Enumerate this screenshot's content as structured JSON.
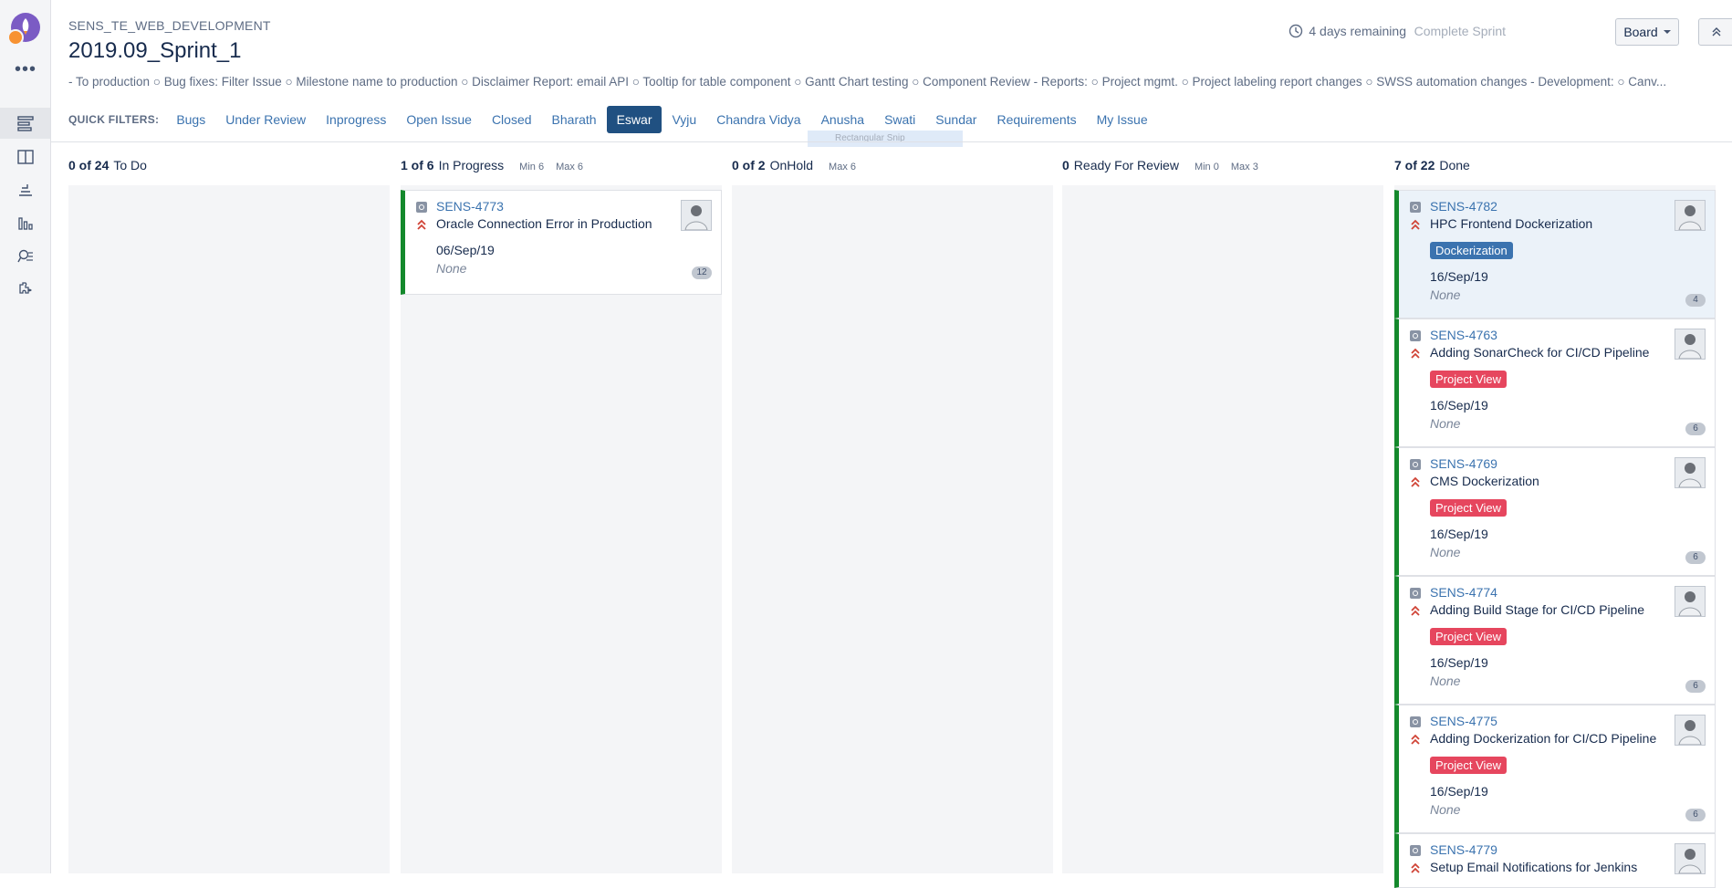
{
  "project": {
    "name": "SENS_TE_WEB_DEVELOPMENT"
  },
  "sprint": {
    "title": "2019.09_Sprint_1",
    "goal": "- To production ○ Bug fixes: Filter Issue ○ Milestone name to production ○ Disclaimer Report: email API ○ Tooltip for table component ○ Gantt Chart testing ○ Component Review - Reports: ○ Project mgmt. ○ Project labeling report changes ○ SWSS automation changes - Development: ○ Canv...",
    "remaining": "4 days remaining",
    "complete_label": "Complete Sprint"
  },
  "toolbar": {
    "board_label": "Board"
  },
  "quick_filters": {
    "label": "QUICK FILTERS:",
    "items": [
      "Bugs",
      "Under Review",
      "Inprogress",
      "Open Issue",
      "Closed",
      "Bharath",
      "Eswar",
      "Vyju",
      "Chandra Vidya",
      "Anusha",
      "Swati",
      "Sundar",
      "Requirements",
      "My Issue"
    ],
    "active": "Eswar"
  },
  "snip_overlay": "Rectangular Snip",
  "columns": [
    {
      "count": "0 of 24",
      "name": "To Do",
      "min": "",
      "max": ""
    },
    {
      "count": "1 of 6",
      "name": "In Progress",
      "min": "Min 6",
      "max": "Max 6"
    },
    {
      "count": "0 of 2",
      "name": "OnHold",
      "min": "",
      "max": "Max 6"
    },
    {
      "count": "0",
      "name": "Ready For Review",
      "min": "Min 0",
      "max": "Max 3"
    },
    {
      "count": "7 of 22",
      "name": "Done",
      "min": "",
      "max": ""
    }
  ],
  "cards_inprogress": [
    {
      "key": "SENS-4773",
      "summary": "Oracle Connection Error in Production",
      "date": "06/Sep/19",
      "due": "None",
      "count": "12"
    }
  ],
  "cards_done": [
    {
      "key": "SENS-4782",
      "summary": "HPC Frontend Dockerization",
      "epic": "Dockerization",
      "date": "16/Sep/19",
      "due": "None",
      "count": "4"
    },
    {
      "key": "SENS-4763",
      "summary": "Adding SonarCheck for CI/CD Pipeline",
      "epic": "Project View",
      "date": "16/Sep/19",
      "due": "None",
      "count": "6"
    },
    {
      "key": "SENS-4769",
      "summary": "CMS Dockerization",
      "epic": "Project View",
      "date": "16/Sep/19",
      "due": "None",
      "count": "6"
    },
    {
      "key": "SENS-4774",
      "summary": "Adding Build Stage for CI/CD Pipeline",
      "epic": "Project View",
      "date": "16/Sep/19",
      "due": "None",
      "count": "6"
    },
    {
      "key": "SENS-4775",
      "summary": "Adding Dockerization for CI/CD Pipeline",
      "epic": "Project View",
      "date": "16/Sep/19",
      "due": "None",
      "count": "6"
    },
    {
      "key": "SENS-4779",
      "summary": "Setup Email Notifications for Jenkins"
    }
  ],
  "colors": {
    "accent": "#205081",
    "link": "#3b73af",
    "done_bar": "#14892c",
    "epic_blue": "#3b73af",
    "epic_pink": "#e6465e",
    "priority": "#d04437"
  },
  "icons": [
    "app-logo-icon",
    "more-icon",
    "backlog-icon",
    "board-icon",
    "releases-icon",
    "reports-icon",
    "issues-search-icon",
    "addons-icon",
    "clock-icon",
    "chevron-down-icon",
    "collapse-icon",
    "story-type-icon",
    "highest-priority-icon"
  ]
}
